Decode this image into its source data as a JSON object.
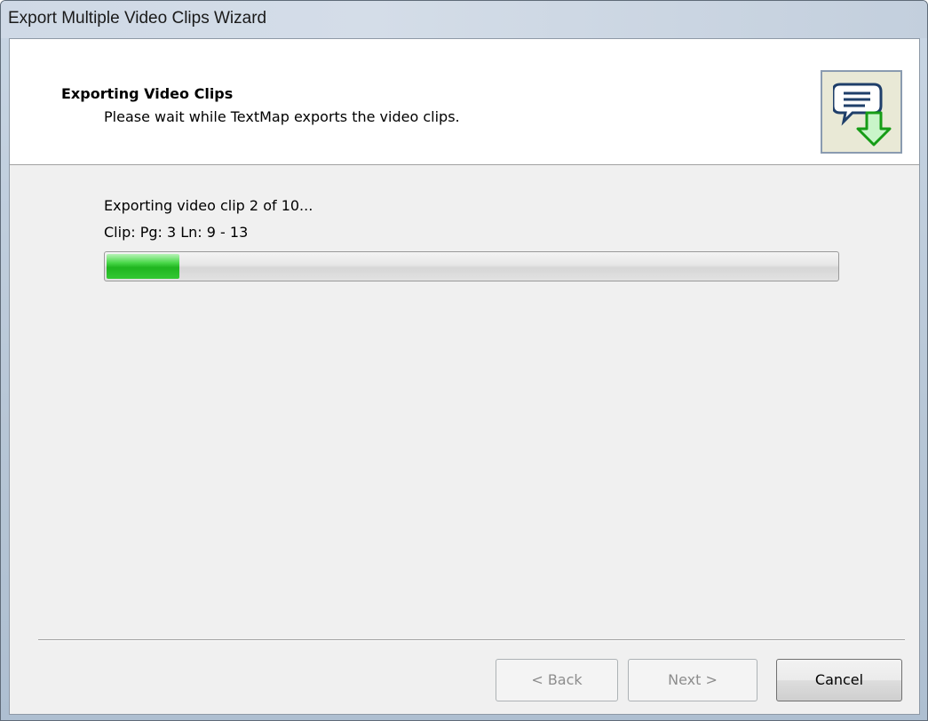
{
  "window": {
    "title": "Export Multiple Video Clips Wizard"
  },
  "header": {
    "title": "Exporting Video Clips",
    "subtitle": "Please wait while TextMap exports the video clips.",
    "icon": "chat-bubble-download-icon"
  },
  "status": {
    "line1": "Exporting video clip 2 of 10...",
    "line2": "Clip: Pg: 3 Ln: 9 - 13"
  },
  "progress": {
    "percent": 10,
    "color": "#26c026"
  },
  "buttons": {
    "back": "< Back",
    "next": "Next >",
    "cancel": "Cancel"
  }
}
